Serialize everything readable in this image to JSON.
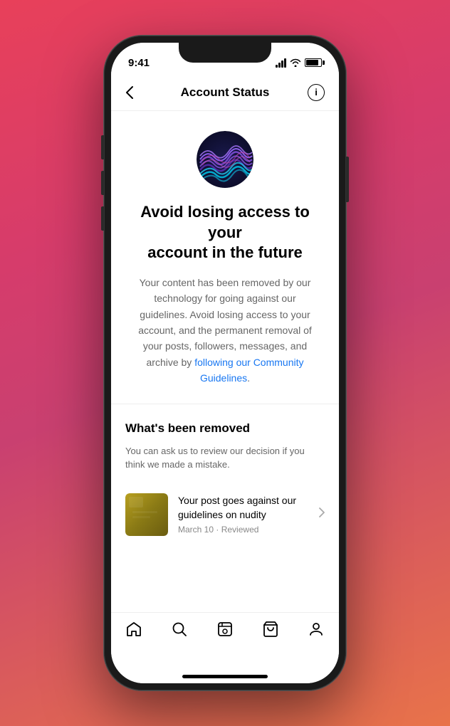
{
  "phone": {
    "status_bar": {
      "time": "9:41"
    },
    "nav": {
      "title": "Account Status",
      "back_label": "‹",
      "info_label": "i"
    },
    "hero": {
      "heading_line1": "Avoid losing access to your",
      "heading_line2": "account in the future",
      "description_before_link": "Your content has been removed by our technology for going against our guidelines. Avoid losing access to your account, and the permanent removal of your posts, followers, messages, and archive by ",
      "link_text": "following our Community Guidelines",
      "description_after_link": "."
    },
    "removed_section": {
      "title": "What's been removed",
      "description": "You can ask us to review our decision if you think we made a mistake.",
      "post": {
        "title": "Your post goes against our guidelines on nudity",
        "date": "March 10",
        "separator": "·",
        "status": "Reviewed"
      }
    },
    "tabs": [
      {
        "name": "home",
        "icon": "home"
      },
      {
        "name": "search",
        "icon": "search"
      },
      {
        "name": "reels",
        "icon": "reels"
      },
      {
        "name": "shop",
        "icon": "shop"
      },
      {
        "name": "profile",
        "icon": "profile"
      }
    ]
  }
}
